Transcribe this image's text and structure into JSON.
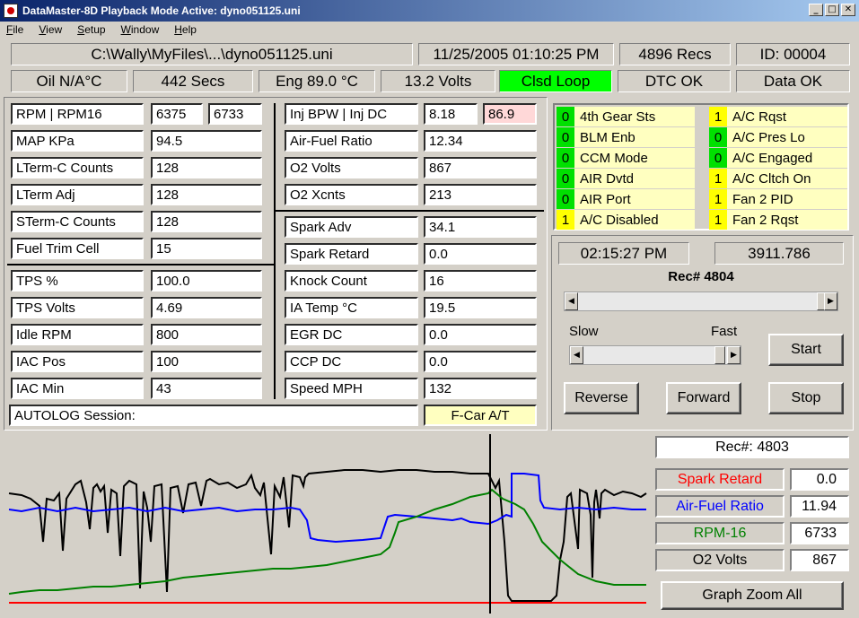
{
  "title": "DataMaster-8D  Playback Mode Active: dyno051125.uni",
  "menu": [
    "File",
    "View",
    "Setup",
    "Window",
    "Help"
  ],
  "header": {
    "path": "C:\\Wally\\MyFiles\\...\\dyno051125.uni",
    "datetime": "11/25/2005  01:10:25 PM",
    "recs": "4896 Recs",
    "id": "ID:  00004"
  },
  "status": {
    "oil": "Oil  N/A°C",
    "secs": "442 Secs",
    "eng": "Eng  89.0 °C",
    "volts": "13.2 Volts",
    "loop": "Clsd Loop",
    "dtc": "DTC OK",
    "data": "Data OK"
  },
  "colors": {
    "green": "#00ff00",
    "pink": "#ffd8d8",
    "yellow": "#ffff00",
    "graph_black": "#000000",
    "graph_blue": "#0000ff",
    "graph_green": "#008000",
    "graph_red": "#ff0000"
  },
  "left_params": [
    {
      "label": "RPM   |   RPM16",
      "v1": "6375",
      "v2": "6733"
    },
    {
      "label": "MAP KPa",
      "v1": "94.5"
    },
    {
      "label": "LTerm-C Counts",
      "v1": "128"
    },
    {
      "label": "LTerm Adj",
      "v1": "128"
    },
    {
      "label": "STerm-C Counts",
      "v1": "128"
    },
    {
      "label": "Fuel Trim Cell",
      "v1": "15"
    },
    {
      "label": "TPS %",
      "v1": "100.0"
    },
    {
      "label": "TPS Volts",
      "v1": "4.69"
    },
    {
      "label": "Idle RPM",
      "v1": "800"
    },
    {
      "label": "IAC Pos",
      "v1": "100"
    },
    {
      "label": "IAC Min",
      "v1": "43"
    }
  ],
  "mid_params": [
    {
      "label": "Inj BPW  |  Inj DC",
      "v1": "8.18",
      "v2": "86.9"
    },
    {
      "label": "Air-Fuel Ratio",
      "v1": "12.34"
    },
    {
      "label": "O2 Volts",
      "v1": "867"
    },
    {
      "label": "O2 Xcnts",
      "v1": "213"
    },
    {
      "label": "Spark Adv",
      "v1": "34.1"
    },
    {
      "label": "Spark Retard",
      "v1": "0.0"
    },
    {
      "label": "Knock Count",
      "v1": "16"
    },
    {
      "label": "IA Temp °C",
      "v1": "19.5"
    },
    {
      "label": "EGR DC",
      "v1": "0.0"
    },
    {
      "label": "CCP DC",
      "v1": "0.0"
    },
    {
      "label": "Speed MPH",
      "v1": "132"
    }
  ],
  "autolog": "AUTOLOG Session:",
  "car": "F-Car A/T",
  "flags_left": [
    {
      "v": "0",
      "label": "4th Gear Sts"
    },
    {
      "v": "0",
      "label": "BLM Enb"
    },
    {
      "v": "0",
      "label": "CCM Mode"
    },
    {
      "v": "0",
      "label": "AIR Dvtd"
    },
    {
      "v": "0",
      "label": "AIR Port"
    },
    {
      "v": "1",
      "label": "A/C Disabled"
    }
  ],
  "flags_right": [
    {
      "v": "1",
      "label": "A/C Rqst"
    },
    {
      "v": "0",
      "label": "A/C Pres Lo"
    },
    {
      "v": "0",
      "label": "A/C Engaged"
    },
    {
      "v": "1",
      "label": "A/C Cltch On"
    },
    {
      "v": "1",
      "label": "Fan 2 PID"
    },
    {
      "v": "1",
      "label": "Fan 2 Rqst"
    }
  ],
  "playback": {
    "time": "02:15:27 PM",
    "elapsed": "3911.786",
    "rec": "Rec# 4804",
    "slow": "Slow",
    "fast": "Fast",
    "start": "Start",
    "reverse": "Reverse",
    "forward": "Forward",
    "stop": "Stop"
  },
  "graph": {
    "rec": "Rec#:  4803",
    "legend": [
      {
        "name": "Spark Retard",
        "value": "0.0",
        "color": "#ff0000"
      },
      {
        "name": "Air-Fuel Ratio",
        "value": "11.94",
        "color": "#0000ff"
      },
      {
        "name": "RPM-16",
        "value": "6733",
        "color": "#008000"
      },
      {
        "name": "O2 Volts",
        "value": "867",
        "color": "#000000"
      }
    ],
    "zoom": "Graph Zoom All"
  }
}
